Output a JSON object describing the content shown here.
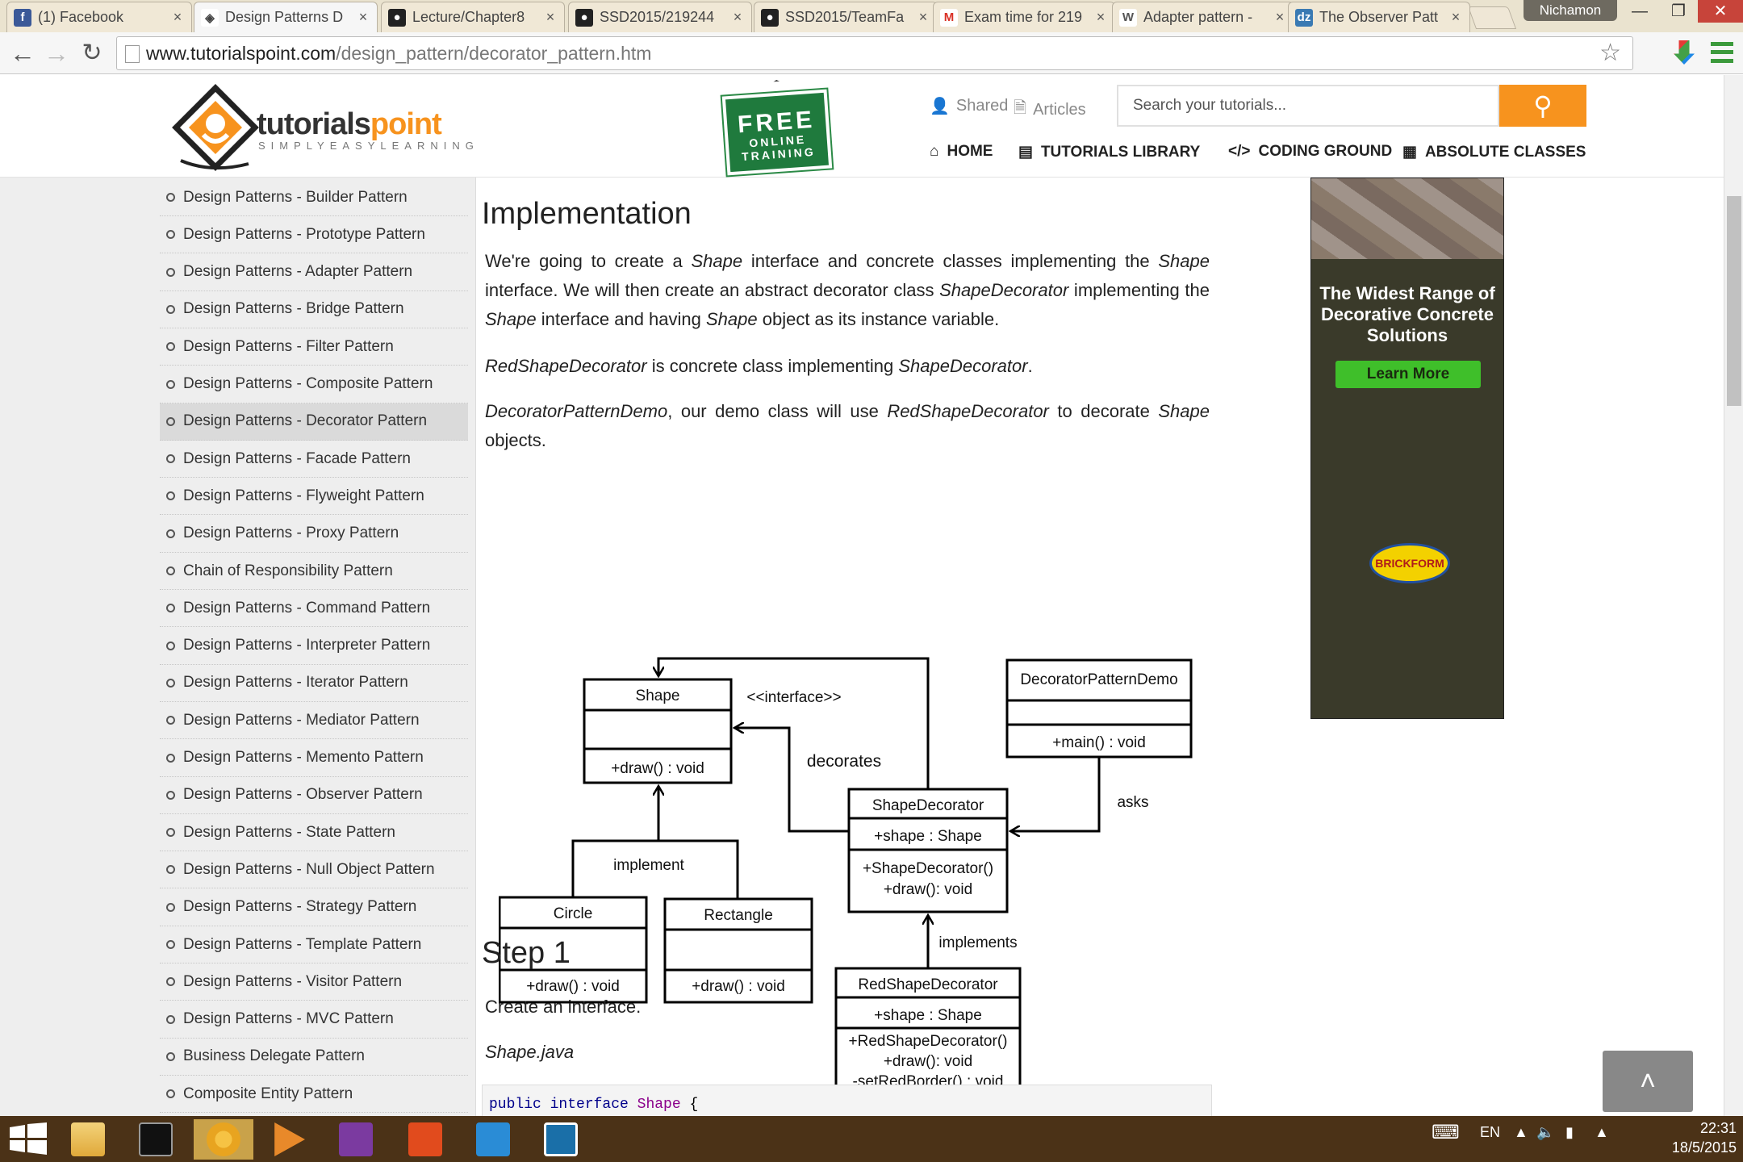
{
  "browser": {
    "tabs": [
      {
        "title": "(1) Facebook",
        "icon": "facebook-icon",
        "color": "#3b5998"
      },
      {
        "title": "Design Patterns D",
        "icon": "tutorialspoint-icon",
        "color": "#444444"
      },
      {
        "title": "Lecture/Chapter8",
        "icon": "github-icon",
        "color": "#222222"
      },
      {
        "title": "SSD2015/219244",
        "icon": "github-icon",
        "color": "#222222"
      },
      {
        "title": "SSD2015/TeamFa",
        "icon": "github-icon",
        "color": "#222222"
      },
      {
        "title": "Exam time for 219",
        "icon": "gmail-icon",
        "color": "#d93025"
      },
      {
        "title": "Adapter pattern -",
        "icon": "wikipedia-icon",
        "color": "#555555"
      },
      {
        "title": "The Observer Patt",
        "icon": "dzone-icon",
        "color": "#3a7ab3"
      }
    ],
    "close_glyph": "×",
    "user": "Nichamon",
    "url_host": "www.tutorialspoint.com",
    "url_path": "/design_pattern/decorator_pattern.htm"
  },
  "header": {
    "logo_main": "tutorials",
    "logo_accent": "point",
    "logo_tagline": "SIMPLYEASYLEARNING",
    "badge_big": "FREE",
    "badge_small_1": "ONLINE",
    "badge_small_2": "TRAINING",
    "shared": "Shared",
    "articles": "Articles",
    "search_placeholder": "Search your tutorials...",
    "nav": [
      "HOME",
      "TUTORIALS LIBRARY",
      "CODING GROUND",
      "ABSOLUTE CLASSES"
    ]
  },
  "sidebar": {
    "items": [
      "Design Patterns - Builder Pattern",
      "Design Patterns - Prototype Pattern",
      "Design Patterns - Adapter Pattern",
      "Design Patterns - Bridge Pattern",
      "Design Patterns - Filter Pattern",
      "Design Patterns - Composite Pattern",
      "Design Patterns - Decorator Pattern",
      "Design Patterns - Facade Pattern",
      "Design Patterns - Flyweight Pattern",
      "Design Patterns - Proxy Pattern",
      "Chain of Responsibility Pattern",
      "Design Patterns - Command Pattern",
      "Design Patterns - Interpreter Pattern",
      "Design Patterns - Iterator Pattern",
      "Design Patterns - Mediator Pattern",
      "Design Patterns - Memento Pattern",
      "Design Patterns - Observer Pattern",
      "Design Patterns - State Pattern",
      "Design Patterns - Null Object Pattern",
      "Design Patterns - Strategy Pattern",
      "Design Patterns - Template Pattern",
      "Design Patterns - Visitor Pattern",
      "Design Patterns - MVC Pattern",
      "Business Delegate Pattern",
      "Composite Entity Pattern"
    ],
    "active_index": 6
  },
  "content": {
    "heading": "Implementation",
    "p1": [
      {
        "t": "We're going to create a ",
        "i": false
      },
      {
        "t": "Shape",
        "i": true
      },
      {
        "t": " interface and concrete classes implementing the ",
        "i": false
      },
      {
        "t": "Shape",
        "i": true
      },
      {
        "t": " interface. We will then create an abstract decorator class ",
        "i": false
      },
      {
        "t": "ShapeDecorator",
        "i": true
      },
      {
        "t": " implementing the ",
        "i": false
      },
      {
        "t": "Shape",
        "i": true
      },
      {
        "t": " interface and having ",
        "i": false
      },
      {
        "t": "Shape",
        "i": true
      },
      {
        "t": " object as its instance variable.",
        "i": false
      }
    ],
    "p2": [
      {
        "t": "RedShapeDecorator",
        "i": true
      },
      {
        "t": " is concrete class implementing ",
        "i": false
      },
      {
        "t": "ShapeDecorator",
        "i": true
      },
      {
        "t": ".",
        "i": false
      }
    ],
    "p3": [
      {
        "t": "DecoratorPatternDemo",
        "i": true
      },
      {
        "t": ", our demo class will use ",
        "i": false
      },
      {
        "t": "RedShapeDecorator",
        "i": true
      },
      {
        "t": " to decorate ",
        "i": false
      },
      {
        "t": "Shape",
        "i": true
      },
      {
        "t": " objects.",
        "i": false
      }
    ],
    "step_heading": "Step 1",
    "step_text": "Create an interface.",
    "file_name": "Shape.java",
    "code_kw1": "public",
    "code_kw2": "interface",
    "code_type": "Shape",
    "code_brace": "{"
  },
  "diagram": {
    "classes": {
      "shape": {
        "name": "Shape",
        "methods": [
          "+draw() : void"
        ]
      },
      "circle": {
        "name": "Circle",
        "methods": [
          "+draw() : void"
        ]
      },
      "rectangle": {
        "name": "Rectangle",
        "methods": [
          "+draw() : void"
        ]
      },
      "shape_decorator": {
        "name": "ShapeDecorator",
        "attrs": [
          "+shape : Shape"
        ],
        "methods": [
          "+ShapeDecorator()",
          "+draw(): void"
        ]
      },
      "red_shape_decorator": {
        "name": "RedShapeDecorator",
        "attrs": [
          "+shape : Shape"
        ],
        "methods": [
          "+RedShapeDecorator()",
          "+draw(): void",
          "-setRedBorder() : void"
        ]
      },
      "demo": {
        "name": "DecoratorPatternDemo",
        "methods": [
          "+main() : void"
        ]
      }
    },
    "labels": {
      "interface": "<<interface>>",
      "decorates": "decorates",
      "implement": "implement",
      "implements": "implements",
      "asks": "asks"
    }
  },
  "ad": {
    "headline": "The Widest Range of Decorative Concrete Solutions",
    "button": "Learn More",
    "logo": "BRICKFORM"
  },
  "taskbar": {
    "apps": [
      "file-explorer-icon",
      "command-prompt-icon",
      "chrome-icon",
      "media-player-icon",
      "onenote-icon",
      "office-icon",
      "visual-studio-icon",
      "photo-viewer-icon"
    ],
    "lang": "EN",
    "time": "22:31",
    "date": "18/5/2015"
  }
}
